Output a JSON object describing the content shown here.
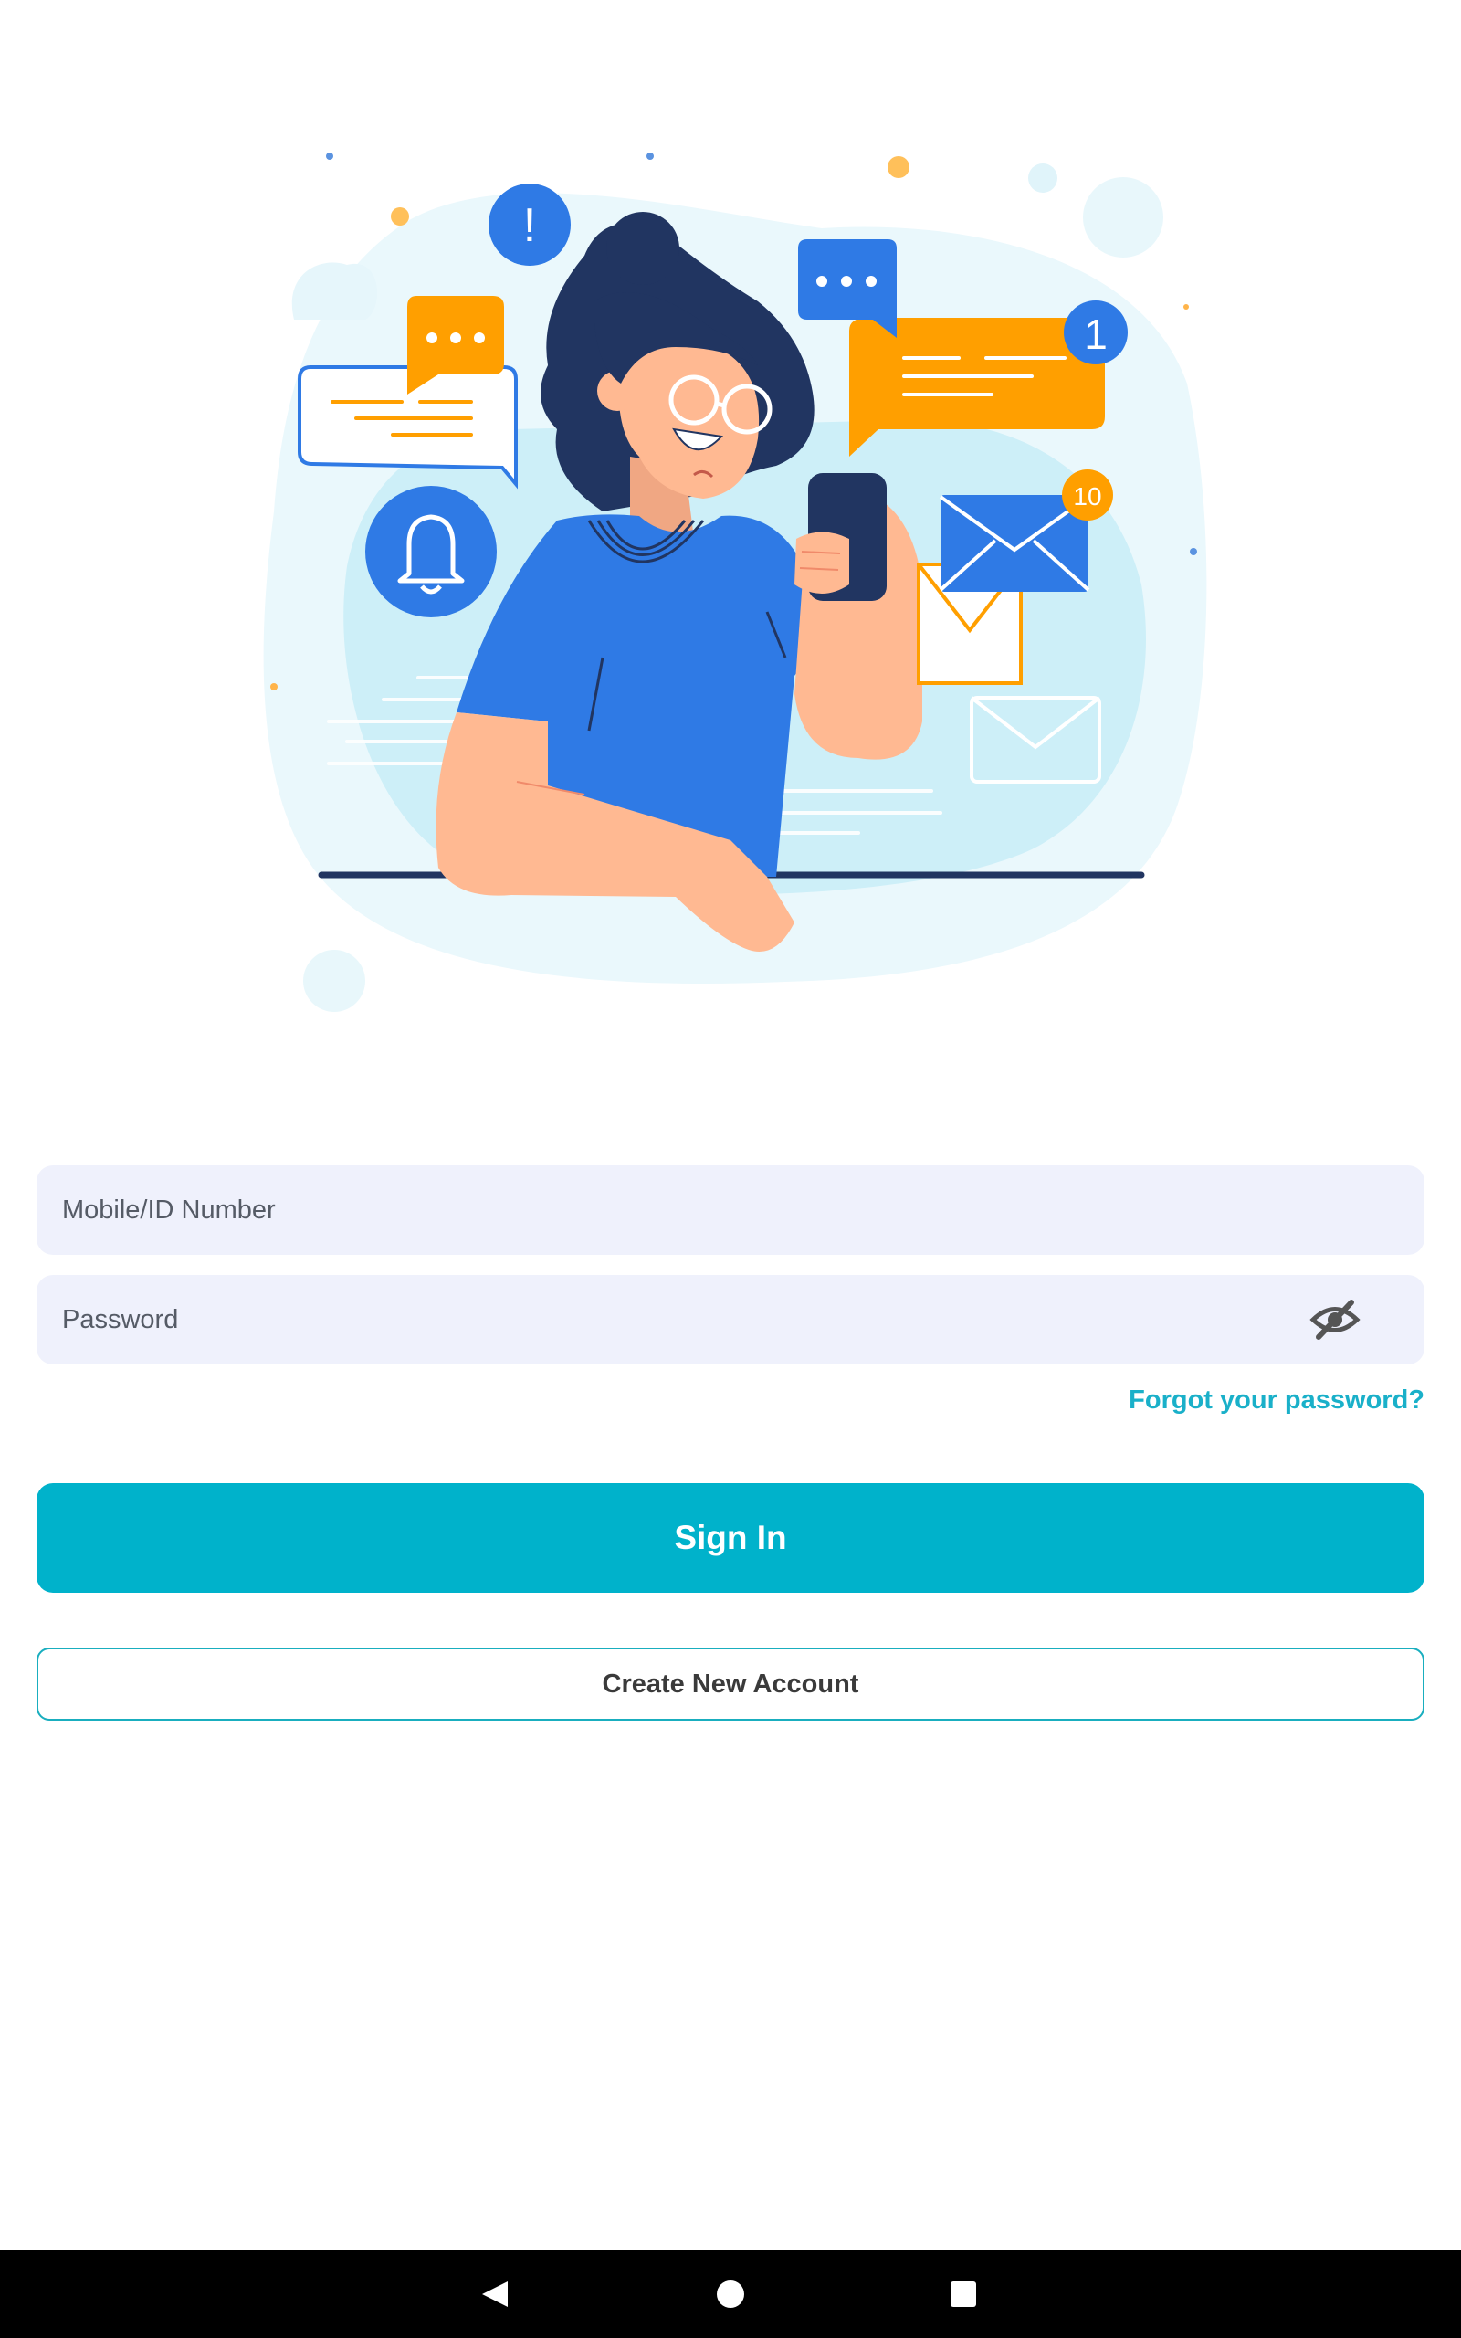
{
  "login": {
    "mobile_placeholder": "Mobile/ID Number",
    "password_placeholder": "Password",
    "forgot_label": "Forgot your password?",
    "signin_label": "Sign In",
    "create_label": "Create New Account"
  },
  "illustration": {
    "chat_badge_count": "1",
    "mail_badge_count": "10",
    "alert_mark": "!"
  },
  "icons": {
    "password_toggle": "eye-slash-icon",
    "nav_back": "back-triangle-icon",
    "nav_home": "home-circle-icon",
    "nav_recents": "recents-square-icon"
  },
  "colors": {
    "accent": "#00b2cb",
    "link": "#1ab0c9",
    "field_bg": "#eff1fc",
    "illustration_blue": "#2f7ae5",
    "illustration_orange": "#ff9f00",
    "illustration_navy": "#213561"
  }
}
